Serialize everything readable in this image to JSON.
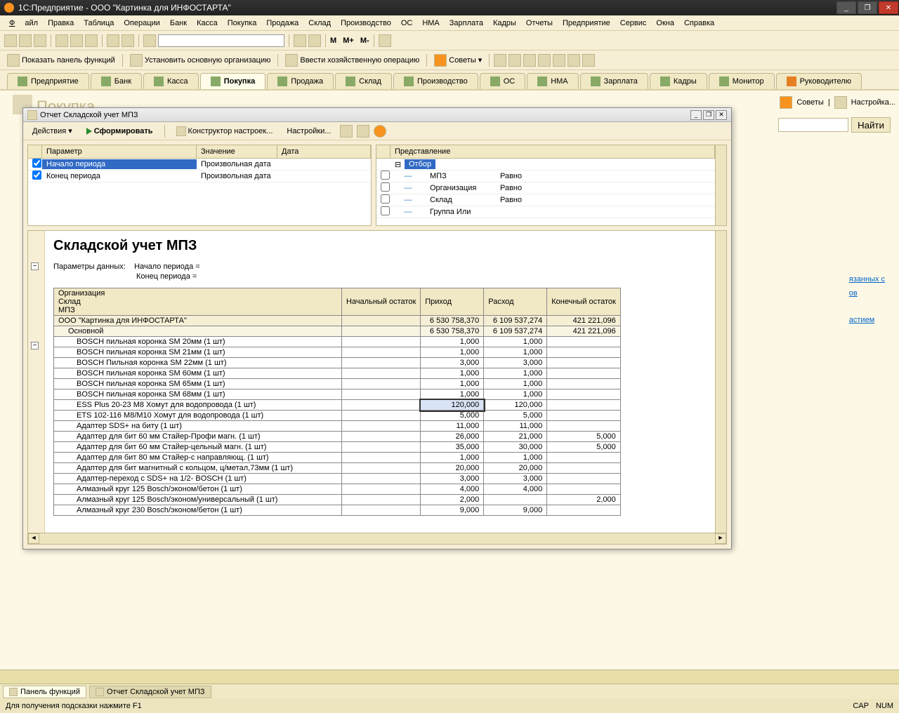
{
  "window_title": "1С:Предприятие - ООО \"Картинка для ИНФОСТАРТА\"",
  "menu": [
    "Файл",
    "Правка",
    "Таблица",
    "Операции",
    "Банк",
    "Касса",
    "Покупка",
    "Продажа",
    "Склад",
    "Производство",
    "ОС",
    "НМА",
    "Зарплата",
    "Кадры",
    "Отчеты",
    "Предприятие",
    "Сервис",
    "Окна",
    "Справка"
  ],
  "toolbar2": {
    "btn1": "Показать панель функций",
    "btn2": "Установить основную организацию",
    "btn3": "Ввести хозяйственную операцию",
    "btn4": "Советы"
  },
  "tb1_letters": {
    "m": "M",
    "mp": "M+",
    "mm": "M-"
  },
  "section_tabs": [
    "Предприятие",
    "Банк",
    "Касса",
    "Покупка",
    "Продажа",
    "Склад",
    "Производство",
    "ОС",
    "НМА",
    "Зарплата",
    "Кадры",
    "Монитор",
    "Руководителю"
  ],
  "active_section": 3,
  "bg_title": "Покупка",
  "right_links": {
    "sovety": "Советы",
    "nastroyka": "Настройка..."
  },
  "search_btn": "Найти",
  "side_links": [
    "язанных с",
    "ов",
    "астием"
  ],
  "report": {
    "title": "Отчет  Складской учет МПЗ",
    "tb": {
      "actions": "Действия",
      "form": "Сформировать",
      "konstr": "Конструктор настроек...",
      "settings": "Настройки..."
    },
    "params_left": {
      "headers": [
        "Параметр",
        "Значение",
        "Дата"
      ],
      "rows": [
        {
          "p": "Начало периода",
          "v": "Произвольная дата",
          "sel": true
        },
        {
          "p": "Конец периода",
          "v": "Произвольная дата",
          "sel": false
        }
      ]
    },
    "params_right": {
      "header": "Представление",
      "root": "Отбор",
      "rows": [
        {
          "n": "МПЗ",
          "op": "Равно"
        },
        {
          "n": "Организация",
          "op": "Равно"
        },
        {
          "n": "Склад",
          "op": "Равно"
        },
        {
          "n": "Группа Или",
          "op": ""
        }
      ]
    },
    "body": {
      "heading": "Складской учет МПЗ",
      "param_label": "Параметры данных:",
      "param1": "Начало периода =",
      "param2": "Конец периода =",
      "cols": [
        {
          "l1": "Организация",
          "l2": "Склад",
          "l3": "МПЗ"
        },
        "Начальный остаток",
        "Приход",
        "Расход",
        "Конечный остаток"
      ],
      "rows": [
        {
          "lvl": 0,
          "n": "ООО \"Картинка для ИНФОСТАРТА\"",
          "c1": "",
          "c2": "6 530 758,370",
          "c3": "6 109 537,274",
          "c4": "421 221,096"
        },
        {
          "lvl": 1,
          "n": "Основной",
          "c1": "",
          "c2": "6 530 758,370",
          "c3": "6 109 537,274",
          "c4": "421 221,096"
        },
        {
          "lvl": 2,
          "n": "BOSCH пильная коронка SM 20мм (1 шт)",
          "c1": "",
          "c2": "1,000",
          "c3": "1,000",
          "c4": ""
        },
        {
          "lvl": 2,
          "n": "BOSCH пильная коронка SM 21мм (1 шт)",
          "c1": "",
          "c2": "1,000",
          "c3": "1,000",
          "c4": ""
        },
        {
          "lvl": 2,
          "n": "BOSCH Пильная коронка SM 22мм (1 шт)",
          "c1": "",
          "c2": "3,000",
          "c3": "3,000",
          "c4": ""
        },
        {
          "lvl": 2,
          "n": "BOSCH пильная коронка SM 60мм (1 шт)",
          "c1": "",
          "c2": "1,000",
          "c3": "1,000",
          "c4": ""
        },
        {
          "lvl": 2,
          "n": "BOSCH пильная коронка SM 65мм (1 шт)",
          "c1": "",
          "c2": "1,000",
          "c3": "1,000",
          "c4": ""
        },
        {
          "lvl": 2,
          "n": "BOSCH пильная коронка SM 68мм (1 шт)",
          "c1": "",
          "c2": "1,000",
          "c3": "1,000",
          "c4": ""
        },
        {
          "lvl": 2,
          "n": "ESS Plus 20-23 M8 Хомут для водопровода     (1 шт)",
          "c1": "",
          "c2": "120,000",
          "c3": "120,000",
          "c4": "",
          "sel": true
        },
        {
          "lvl": 2,
          "n": "ETS 102-116 M8/M10  Хомут для водопровода     (1 шт)",
          "c1": "",
          "c2": "5,000",
          "c3": "5,000",
          "c4": ""
        },
        {
          "lvl": 2,
          "n": "Адаптер SDS+ на биту           (1 шт)",
          "c1": "",
          "c2": "11,000",
          "c3": "11,000",
          "c4": ""
        },
        {
          "lvl": 2,
          "n": "Адаптер для бит 60 мм Стайер-Профи  магн.    (1 шт)",
          "c1": "",
          "c2": "26,000",
          "c3": "21,000",
          "c4": "5,000"
        },
        {
          "lvl": 2,
          "n": "Адаптер для бит 60 мм Стайер-цельный магн.  (1 шт)",
          "c1": "",
          "c2": "35,000",
          "c3": "30,000",
          "c4": "5,000"
        },
        {
          "lvl": 2,
          "n": "Адаптер для бит 80 мм Стайер-с направляющ.  (1 шт)",
          "c1": "",
          "c2": "1,000",
          "c3": "1,000",
          "c4": ""
        },
        {
          "lvl": 2,
          "n": "Адаптер для бит магнитный с кольцом, ц/метал,73мм (1 шт)",
          "c1": "",
          "c2": "20,000",
          "c3": "20,000",
          "c4": ""
        },
        {
          "lvl": 2,
          "n": "Адаптер-переход с SDS+ на 1/2- BOSCH        (1 шт)",
          "c1": "",
          "c2": "3,000",
          "c3": "3,000",
          "c4": ""
        },
        {
          "lvl": 2,
          "n": "Алмазный круг 125 Bosch/эконом/бетон  (1 шт)",
          "c1": "",
          "c2": "4,000",
          "c3": "4,000",
          "c4": ""
        },
        {
          "lvl": 2,
          "n": "Алмазный круг 125 Bosch/эконом/универсальный (1 шт)",
          "c1": "",
          "c2": "2,000",
          "c3": "",
          "c4": "2,000"
        },
        {
          "lvl": 2,
          "n": "Алмазный круг 230 Bosch/эконом/бетон (1 шт)",
          "c1": "",
          "c2": "9,000",
          "c3": "9,000",
          "c4": ""
        }
      ]
    }
  },
  "taskbar": {
    "t1": "Панель функций",
    "t2": "Отчет  Складской учет МПЗ"
  },
  "status": {
    "hint": "Для получения подсказки нажмите F1",
    "cap": "CAP",
    "num": "NUM"
  }
}
